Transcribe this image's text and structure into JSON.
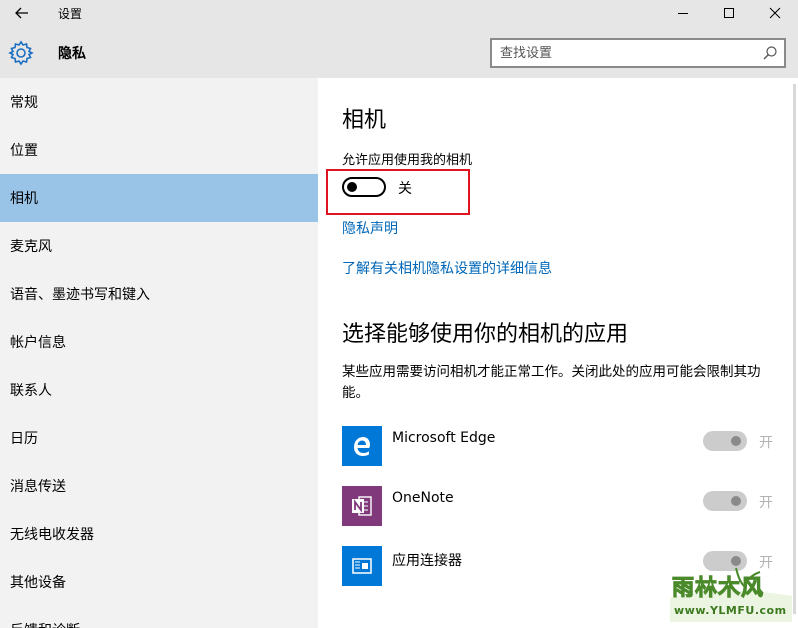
{
  "titlebar": {
    "title": "设置",
    "back_icon": "back-arrow-icon",
    "minimize_icon": "minimize-icon",
    "maximize_icon": "maximize-icon",
    "close_icon": "close-icon"
  },
  "header": {
    "icon": "gear-icon",
    "title": "隐私",
    "search_placeholder": "查找设置",
    "search_value": "",
    "search_icon": "search-icon"
  },
  "sidebar": {
    "items": [
      {
        "label": "常规",
        "active": false
      },
      {
        "label": "位置",
        "active": false
      },
      {
        "label": "相机",
        "active": true
      },
      {
        "label": "麦克风",
        "active": false
      },
      {
        "label": "语音、墨迹书写和键入",
        "active": false
      },
      {
        "label": "帐户信息",
        "active": false
      },
      {
        "label": "联系人",
        "active": false
      },
      {
        "label": "日历",
        "active": false
      },
      {
        "label": "消息传送",
        "active": false
      },
      {
        "label": "无线电收发器",
        "active": false
      },
      {
        "label": "其他设备",
        "active": false
      },
      {
        "label": "反馈和诊断",
        "active": false
      }
    ]
  },
  "main": {
    "title": "相机",
    "allow_label": "允许应用使用我的相机",
    "toggle": {
      "state": "off",
      "label": "关"
    },
    "privacy_link": "隐私声明",
    "learn_more_link": "了解有关相机隐私设置的详细信息",
    "section_title": "选择能够使用你的相机的应用",
    "description": "某些应用需要访问相机才能正常工作。关闭此处的应用可能会限制其功能。",
    "apps": [
      {
        "name": "Microsoft Edge",
        "icon": "edge-icon",
        "color": "#0078d7",
        "toggle_label": "开",
        "enabled": false
      },
      {
        "name": "OneNote",
        "icon": "onenote-icon",
        "color": "#80397b",
        "toggle_label": "开",
        "enabled": false
      },
      {
        "name": "应用连接器",
        "icon": "app-connector-icon",
        "color": "#0078d7",
        "toggle_label": "开",
        "enabled": false
      }
    ]
  },
  "watermark": {
    "title": "雨林木风",
    "url": "www.YLMFU.com"
  },
  "colors": {
    "accent": "#0067b8",
    "active_nav": "#99c4e8",
    "highlight_border": "#e0141e"
  }
}
